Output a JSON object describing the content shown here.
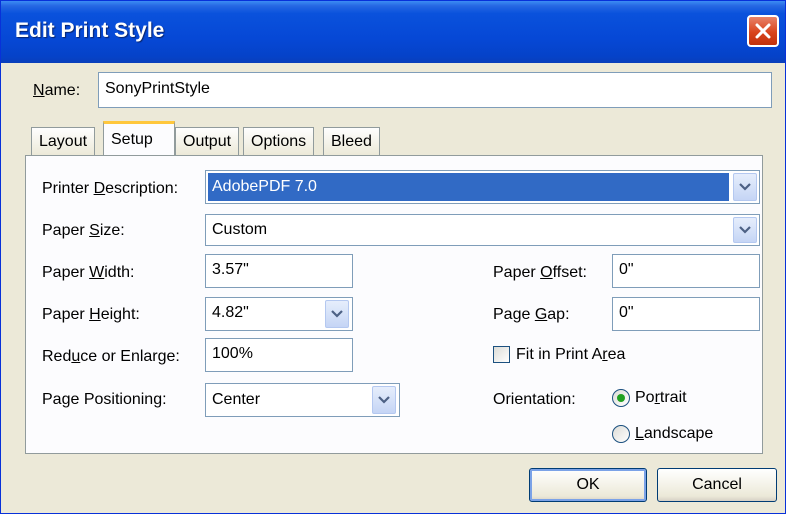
{
  "window": {
    "title": "Edit Print Style"
  },
  "name_label": "Name:",
  "name_value": "SonyPrintStyle",
  "tabs": [
    {
      "label": "Layout",
      "active": false
    },
    {
      "label": "Setup",
      "active": true
    },
    {
      "label": "Output",
      "active": false
    },
    {
      "label": "Options",
      "active": false
    },
    {
      "label": "Bleed",
      "active": false
    }
  ],
  "setup": {
    "printer_description": {
      "label": "Printer Description:",
      "value": "AdobePDF 7.0"
    },
    "paper_size": {
      "label": "Paper Size:",
      "value": "Custom"
    },
    "paper_width": {
      "label": "Paper Width:",
      "value": "3.57\""
    },
    "paper_height": {
      "label": "Paper Height:",
      "value": "4.82\""
    },
    "reduce_enlarge": {
      "label": "Reduce or Enlarge:",
      "value": "100%"
    },
    "page_positioning": {
      "label": "Page Positioning:",
      "value": "Center"
    },
    "paper_offset": {
      "label": "Paper Offset:",
      "value": "0\""
    },
    "page_gap": {
      "label": "Page Gap:",
      "value": "0\""
    },
    "fit_in_print_area": {
      "label": "Fit in Print Area",
      "checked": false
    },
    "orientation": {
      "label": "Orientation:",
      "options": [
        {
          "label": "Portrait",
          "selected": true
        },
        {
          "label": "Landscape",
          "selected": false
        }
      ]
    }
  },
  "buttons": {
    "ok": "OK",
    "cancel": "Cancel"
  },
  "colors": {
    "titlebar": "#0648d6",
    "face": "#ece9d8",
    "selection": "#316ac5",
    "field_border": "#7f9db9"
  }
}
